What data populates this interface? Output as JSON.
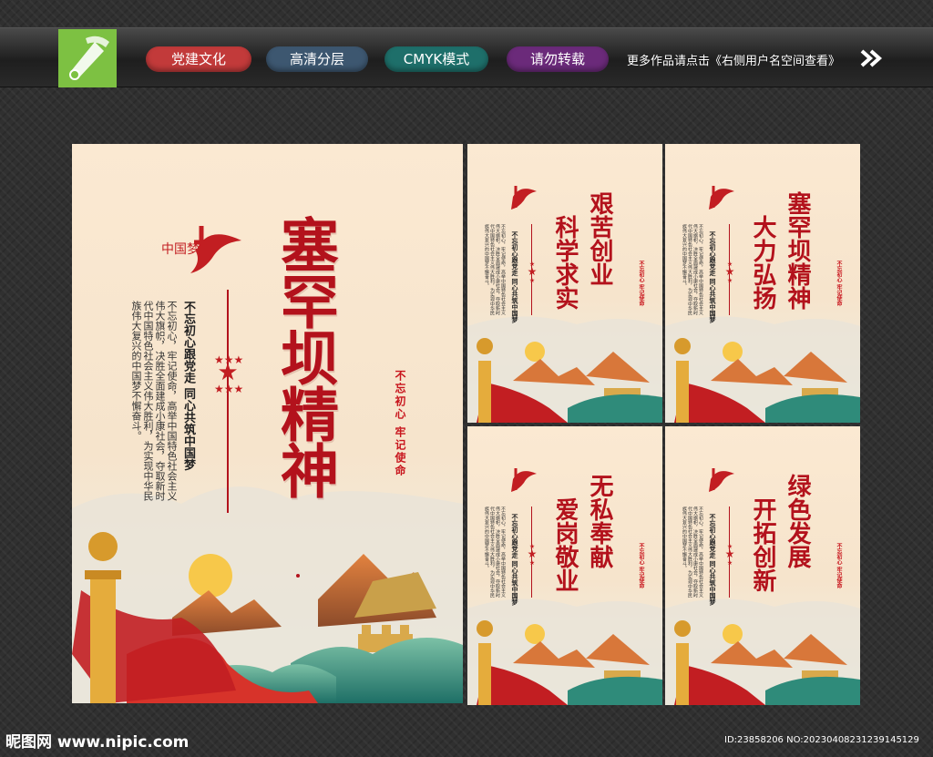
{
  "toolbar": {
    "tags": [
      {
        "label": "党建文化",
        "color": "#c23a3a"
      },
      {
        "label": "高清分层",
        "color": "#3d5770"
      },
      {
        "label": "CMYK模式",
        "color": "#1e6f6a"
      },
      {
        "label": "请勿转载",
        "color": "#6b2a7a"
      }
    ],
    "note": "更多作品请点击《右侧用户名空间查看》"
  },
  "main": {
    "title": "塞罕坝精神",
    "logo_text": "中国梦",
    "slogan": "不忘初心跟党走 同心共筑中国梦",
    "body": "不忘初心，牢记使命，高举中国特色社会主义伟大旗帜，决胜全面建成小康社会，夺取新时代中国特色社会主义伟大胜利，为实现中华民族伟大复兴的中国梦不懈奋斗。",
    "seal": "不忘初心 牢记使命"
  },
  "panels": [
    {
      "line1": "艰苦创业",
      "line2": "科学求实"
    },
    {
      "line1": "塞罕坝精神",
      "line2": "大力弘扬"
    },
    {
      "line1": "无私奉献",
      "line2": "爱岗敬业"
    },
    {
      "line1": "绿色发展",
      "line2": "开拓创新"
    }
  ],
  "panel_common": {
    "slogan": "不忘初心跟党走 同心共筑中国梦",
    "body": "不忘初心，牢记使命，高举中国特色社会主义伟大旗帜，决胜全面建成小康社会，夺取新时代中国特色社会主义伟大胜利，为实现中华民族伟大复兴的中国梦不懈奋斗。",
    "seal": "不忘初心 牢记使命"
  },
  "footer": {
    "site": "昵图网 www.nipic.com",
    "id": "ID:23858206 NO:20230408231239145129"
  }
}
